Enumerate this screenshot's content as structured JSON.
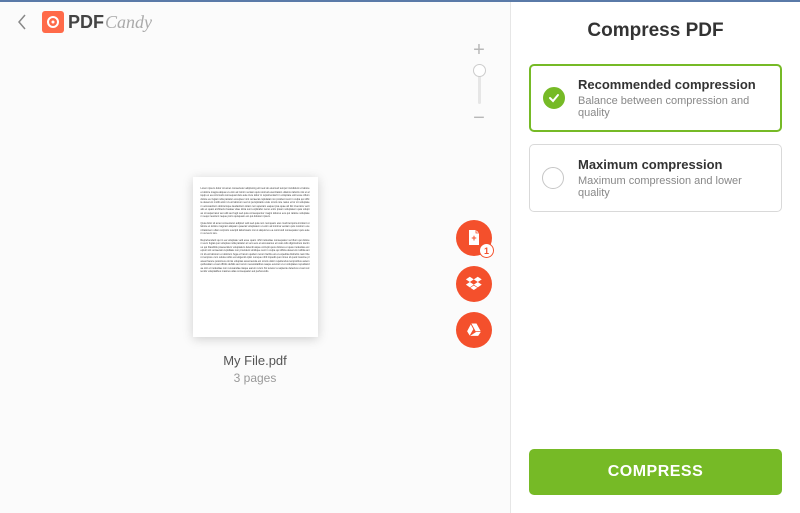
{
  "app": {
    "name_bold": "PDF",
    "name_script": "Candy"
  },
  "panel": {
    "title": "Compress PDF"
  },
  "file": {
    "name": "My File.pdf",
    "pages_label": "3 pages",
    "badge": "1"
  },
  "options": [
    {
      "title": "Recommended compression",
      "desc": "Balance between compression and quality",
      "selected": true
    },
    {
      "title": "Maximum compression",
      "desc": "Maximum compression and lower quality",
      "selected": false
    }
  ],
  "actions": {
    "compress": "COMPRESS"
  },
  "fab": {
    "add_badge": "1"
  },
  "colors": {
    "accent": "#f4502c",
    "primary": "#76ba26"
  }
}
